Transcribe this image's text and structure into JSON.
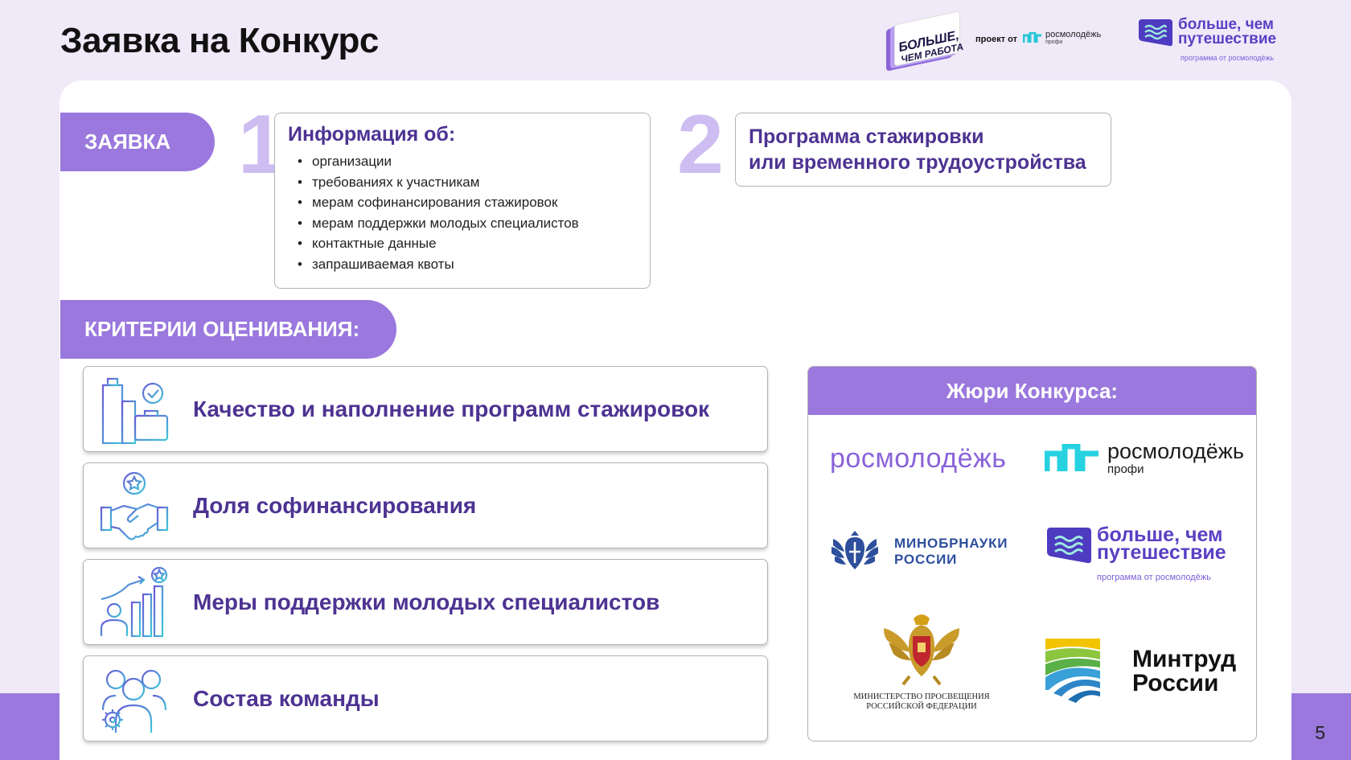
{
  "header": {
    "title": "Заявка на Конкурс",
    "logo_bcr": {
      "line1": "БОЛЬШЕ,",
      "line2": "ЧЕМ РАБОТА",
      "icon": "bolshe-chem-rabota-logo"
    },
    "project_by": "проект от",
    "rm_profi_small": {
      "line1": "росмолодёжь",
      "line2": "профи",
      "icon": "rosmolodezh-profi-logo"
    },
    "bmp_small": {
      "line1": "больше, чем",
      "line2": "путешествие",
      "sub": "программа от росмолодёжь",
      "icon": "bolshe-chem-puteshestvie-logo"
    }
  },
  "application": {
    "pill_label": "ЗАЯВКА",
    "step1": {
      "number": "1",
      "heading": "Информация об:",
      "items": [
        "организации",
        "требованиях к участникам",
        "мерам софинансирования стажировок",
        "мерам поддержки молодых специалистов",
        "контактные данные",
        "запрашиваемая квоты"
      ]
    },
    "step2": {
      "number": "2",
      "line1": "Программа стажировки",
      "line2": "или временного трудоустройства"
    }
  },
  "criteria": {
    "pill_label": "КРИТЕРИИ ОЦЕНИВАНИЯ:",
    "items": [
      {
        "label": "Качество и наполнение программ стажировок",
        "icon": "office-buildings-briefcase-icon"
      },
      {
        "label": "Доля софинансирования",
        "icon": "handshake-star-icon"
      },
      {
        "label": "Меры поддержки молодых специалистов",
        "icon": "growth-chart-person-icon"
      },
      {
        "label": "Состав команды",
        "icon": "team-people-gear-icon"
      }
    ]
  },
  "jury": {
    "heading": "Жюри Конкурса:",
    "logos": [
      {
        "name": "росмолодёжь",
        "icon": "rosmolodezh-logo"
      },
      {
        "line1": "росмолодёжь",
        "line2": "профи",
        "icon": "rosmolodezh-profi-logo"
      },
      {
        "line1": "МИНОБРНАУКИ",
        "line2": "РОССИИ",
        "icon": "minobrnauki-emblem"
      },
      {
        "line1": "больше, чем",
        "line2": "путешествие",
        "sub": "программа от росмолодёжь",
        "icon": "bolshe-chem-puteshestvie-logo"
      },
      {
        "line1": "МИНИСТЕРСТВО ПРОСВЕЩЕНИЯ",
        "line2": "РОССИЙСКОЙ ФЕДЕРАЦИИ",
        "icon": "minprosvesheniya-eagle-emblem"
      },
      {
        "line1": "Минтруд",
        "line2": "России",
        "icon": "mintrud-logo"
      }
    ]
  },
  "page_number": "5",
  "colors": {
    "accent": "#9a78dd",
    "accent_light": "#cdbdf1",
    "heading_text": "#4d3392",
    "background": "#efe9f8"
  }
}
